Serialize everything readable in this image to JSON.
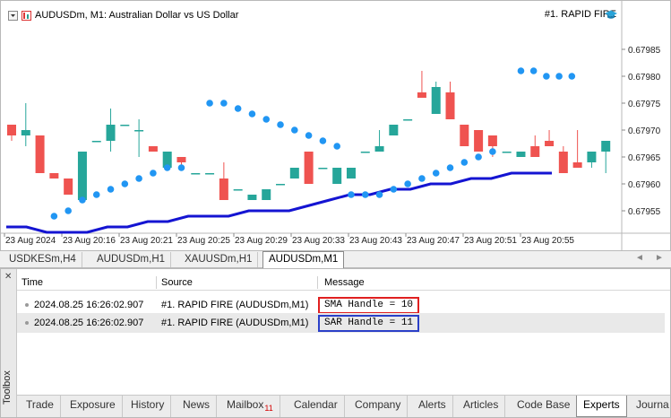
{
  "chart": {
    "symbol_info": "AUDUSDm, M1:  Australian Dollar vs US Dollar",
    "ea_name": "#1. RAPID FIRE",
    "y_labels": [
      "0.67985",
      "0.67980",
      "0.67975",
      "0.67970",
      "0.67965",
      "0.67960",
      "0.67955"
    ],
    "x_labels": [
      "23 Aug 2024",
      "23 Aug 20:16",
      "23 Aug 20:21",
      "23 Aug 20:25",
      "23 Aug 20:29",
      "23 Aug 20:33",
      "23 Aug 20:43",
      "23 Aug 20:47",
      "23 Aug 20:51",
      "23 Aug 20:55"
    ],
    "colors": {
      "bull": "#26a69a",
      "bear": "#ef5350",
      "sar": "#2196f3",
      "sma": "#1414d2"
    }
  },
  "chart_data": {
    "type": "candlestick",
    "ylim": [
      0.67951,
      0.67989
    ],
    "candles": [
      {
        "o": 0.67971,
        "h": 0.67971,
        "l": 0.67968,
        "c": 0.67969
      },
      {
        "o": 0.67969,
        "h": 0.67975,
        "l": 0.67967,
        "c": 0.6797
      },
      {
        "o": 0.67969,
        "h": 0.67969,
        "l": 0.67962,
        "c": 0.67962
      },
      {
        "o": 0.67962,
        "h": 0.67962,
        "l": 0.67961,
        "c": 0.67961
      },
      {
        "o": 0.67961,
        "h": 0.67961,
        "l": 0.67958,
        "c": 0.67958
      },
      {
        "o": 0.67957,
        "h": 0.67966,
        "l": 0.67957,
        "c": 0.67966
      },
      {
        "o": 0.67968,
        "h": 0.67968,
        "l": 0.67968,
        "c": 0.67968
      },
      {
        "o": 0.67968,
        "h": 0.67974,
        "l": 0.67966,
        "c": 0.67971
      },
      {
        "o": 0.67971,
        "h": 0.67971,
        "l": 0.67971,
        "c": 0.67971
      },
      {
        "o": 0.6797,
        "h": 0.67972,
        "l": 0.67965,
        "c": 0.6797
      },
      {
        "o": 0.67967,
        "h": 0.67967,
        "l": 0.67966,
        "c": 0.67966
      },
      {
        "o": 0.67963,
        "h": 0.67966,
        "l": 0.67963,
        "c": 0.67966
      },
      {
        "o": 0.67965,
        "h": 0.67965,
        "l": 0.67963,
        "c": 0.67964
      },
      {
        "o": 0.67962,
        "h": 0.67962,
        "l": 0.67962,
        "c": 0.67962
      },
      {
        "o": 0.67962,
        "h": 0.67962,
        "l": 0.67962,
        "c": 0.67962
      },
      {
        "o": 0.67961,
        "h": 0.67964,
        "l": 0.67957,
        "c": 0.67957
      },
      {
        "o": 0.67959,
        "h": 0.67959,
        "l": 0.67959,
        "c": 0.67959
      },
      {
        "o": 0.67957,
        "h": 0.67958,
        "l": 0.67957,
        "c": 0.67958
      },
      {
        "o": 0.67957,
        "h": 0.67959,
        "l": 0.67957,
        "c": 0.67959
      },
      {
        "o": 0.6796,
        "h": 0.6796,
        "l": 0.6796,
        "c": 0.6796
      },
      {
        "o": 0.67961,
        "h": 0.67963,
        "l": 0.67961,
        "c": 0.67963
      },
      {
        "o": 0.67966,
        "h": 0.67966,
        "l": 0.6796,
        "c": 0.6796
      },
      {
        "o": 0.67963,
        "h": 0.67963,
        "l": 0.67963,
        "c": 0.67963
      },
      {
        "o": 0.6796,
        "h": 0.67963,
        "l": 0.6796,
        "c": 0.67963
      },
      {
        "o": 0.67961,
        "h": 0.67963,
        "l": 0.67961,
        "c": 0.67963
      },
      {
        "o": 0.67966,
        "h": 0.67966,
        "l": 0.67966,
        "c": 0.67966
      },
      {
        "o": 0.67966,
        "h": 0.6797,
        "l": 0.67966,
        "c": 0.67967
      },
      {
        "o": 0.67969,
        "h": 0.67971,
        "l": 0.67969,
        "c": 0.67971
      },
      {
        "o": 0.67972,
        "h": 0.67972,
        "l": 0.67972,
        "c": 0.67972
      },
      {
        "o": 0.67977,
        "h": 0.67981,
        "l": 0.67977,
        "c": 0.67976
      },
      {
        "o": 0.67973,
        "h": 0.67979,
        "l": 0.67973,
        "c": 0.67978
      },
      {
        "o": 0.67977,
        "h": 0.67979,
        "l": 0.67972,
        "c": 0.67972
      },
      {
        "o": 0.67971,
        "h": 0.67971,
        "l": 0.67967,
        "c": 0.67967
      },
      {
        "o": 0.6797,
        "h": 0.6797,
        "l": 0.67966,
        "c": 0.67966
      },
      {
        "o": 0.67969,
        "h": 0.67969,
        "l": 0.67965,
        "c": 0.67967
      },
      {
        "o": 0.67966,
        "h": 0.67966,
        "l": 0.67966,
        "c": 0.67966
      },
      {
        "o": 0.67965,
        "h": 0.67966,
        "l": 0.67965,
        "c": 0.67966
      },
      {
        "o": 0.67967,
        "h": 0.67969,
        "l": 0.67965,
        "c": 0.67965
      },
      {
        "o": 0.67968,
        "h": 0.6797,
        "l": 0.67967,
        "c": 0.67967
      },
      {
        "o": 0.67966,
        "h": 0.67967,
        "l": 0.67962,
        "c": 0.67962
      },
      {
        "o": 0.67964,
        "h": 0.6797,
        "l": 0.67963,
        "c": 0.67963
      },
      {
        "o": 0.67964,
        "h": 0.67966,
        "l": 0.67963,
        "c": 0.67966
      },
      {
        "o": 0.67966,
        "h": 0.67968,
        "l": 0.67962,
        "c": 0.67968
      }
    ],
    "sar_groups": [
      [
        0.67954,
        0.67955,
        0.67957,
        0.67958,
        0.67959,
        0.6796,
        0.67961,
        0.67962,
        0.67963,
        0.67963
      ],
      [
        0.67975,
        0.67975,
        0.67974,
        0.67973,
        0.67972,
        0.67971,
        0.6797,
        0.67969,
        0.67968,
        0.67967
      ],
      [
        0.67958,
        0.67958,
        0.67958,
        0.67959,
        0.6796,
        0.67961,
        0.67962,
        0.67963,
        0.67964,
        0.67965,
        0.67966
      ],
      [
        0.67981,
        0.67981,
        0.6798,
        0.6798,
        0.6798
      ]
    ],
    "sma": [
      0.67952,
      0.67952,
      0.67951,
      0.67951,
      0.67951,
      0.67952,
      0.67952,
      0.67953,
      0.67953,
      0.67954,
      0.67954,
      0.67954,
      0.67955,
      0.67955,
      0.67955,
      0.67956,
      0.67957,
      0.67958,
      0.67958,
      0.67959,
      0.67959,
      0.6796,
      0.6796,
      0.67961,
      0.67961,
      0.67962,
      0.67962,
      0.67962
    ]
  },
  "chart_tabs": [
    "USDKESm,H4",
    "AUDUSDm,H1",
    "XAUUSDm,H1",
    "AUDUSDm,M1"
  ],
  "toolbox": {
    "label": "Toolbox",
    "columns": [
      "Time",
      "Source",
      "Message"
    ],
    "rows": [
      {
        "time": "2024.08.25 16:26:02.907",
        "source": "#1. RAPID FIRE (AUDUSDm,M1)",
        "message": "SMA Handle = 10",
        "border": "#e02020"
      },
      {
        "time": "2024.08.25 16:26:02.907",
        "source": "#1. RAPID FIRE (AUDUSDm,M1)",
        "message": "SAR Handle = 11",
        "border": "#2a3fc8"
      }
    ],
    "tabs": [
      "Trade",
      "Exposure",
      "History",
      "News",
      "Mailbox",
      "Calendar",
      "Company",
      "Alerts",
      "Articles",
      "Code Base",
      "Experts",
      "Journa"
    ],
    "mailbox_badge": "11"
  }
}
